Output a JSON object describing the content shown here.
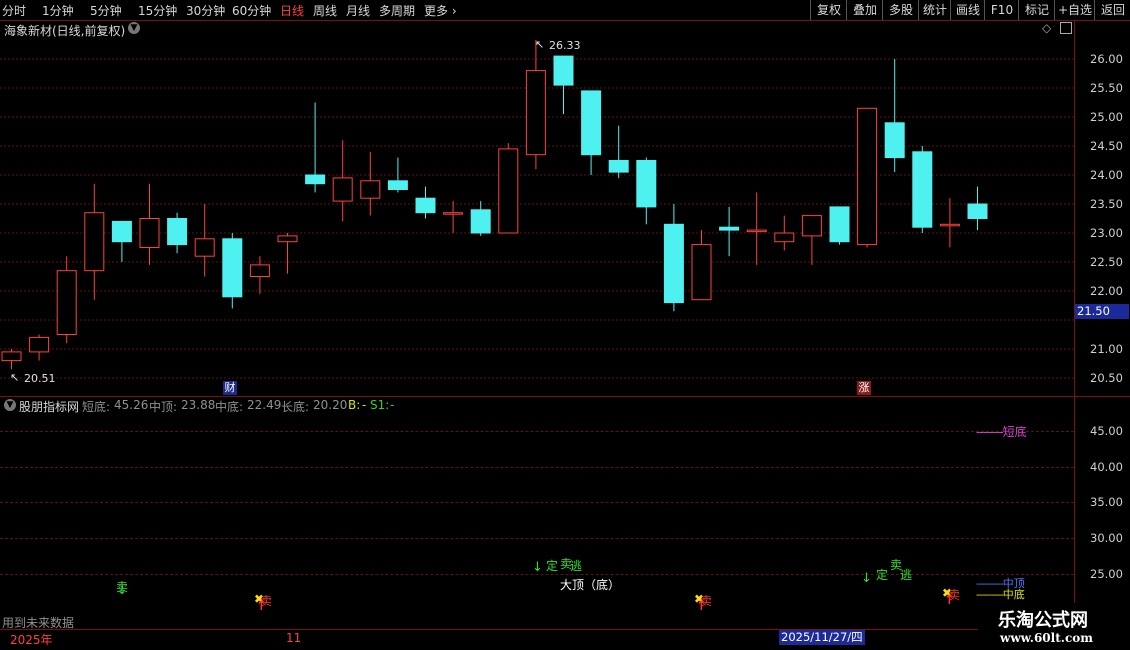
{
  "toolbar": {
    "periods": [
      "分时",
      "1分钟",
      "5分钟",
      "15分钟",
      "30分钟",
      "60分钟",
      "日线",
      "周线",
      "月线",
      "多周期",
      "更多"
    ],
    "active_period": "日线",
    "right_buttons": [
      "复权",
      "叠加",
      "多股",
      "统计",
      "画线",
      "F10",
      "标记",
      "+自选",
      "返回"
    ]
  },
  "main_title": "海象新材(日线,前复权)",
  "price_axis": {
    "labels": [
      "26.00",
      "25.50",
      "25.00",
      "24.50",
      "24.00",
      "23.50",
      "23.00",
      "22.50",
      "22.00",
      "21.50",
      "21.00",
      "20.50"
    ],
    "current_price": "21.50"
  },
  "annotations": {
    "high_label": "26.33",
    "low_label": "20.51",
    "badge_cai": "财",
    "badge_zhang": "涨"
  },
  "indicator": {
    "name": "股朋指标网",
    "params": [
      {
        "label": "短底:",
        "value": "45.26"
      },
      {
        "label": "中顶:",
        "value": "23.88"
      },
      {
        "label": "中底:",
        "value": "22.49"
      },
      {
        "label": "长底:",
        "value": "20.20"
      }
    ],
    "b_label": "B:",
    "b_value": "-",
    "s1_label": "S1:",
    "s1_value": "-",
    "axis_labels": [
      "45.00",
      "40.00",
      "35.00",
      "30.00",
      "25.00"
    ],
    "legend": [
      {
        "label": "短底",
        "color": "#d040d0"
      },
      {
        "label": "中顶",
        "color": "#4a7cff"
      },
      {
        "label": "中底",
        "color": "#e0e000"
      }
    ],
    "signal_texts": {
      "sell": "卖",
      "ding_tao": "定",
      "tao": "逃",
      "big_top": "大顶（底）"
    }
  },
  "footer": {
    "future_note": "用到未来数据",
    "year": "2025年",
    "month": "11",
    "date_cursor": "2025/11/27/四"
  },
  "watermark": {
    "name": "乐淘公式网",
    "url": "www.60lt.com"
  },
  "colors": {
    "up": "#ff4040",
    "down": "#4ff0f0",
    "grid": "#5a1212",
    "active": "#ff4040"
  },
  "chart_data": {
    "type": "candlestick",
    "ylim": [
      20.3,
      26.3
    ],
    "candles": [
      {
        "o": 20.8,
        "c": 20.95,
        "h": 21.0,
        "l": 20.65
      },
      {
        "o": 20.95,
        "c": 21.2,
        "h": 21.25,
        "l": 20.8
      },
      {
        "o": 21.25,
        "c": 22.35,
        "h": 22.6,
        "l": 21.1
      },
      {
        "o": 22.35,
        "c": 23.35,
        "h": 23.85,
        "l": 21.85
      },
      {
        "o": 23.2,
        "c": 22.85,
        "h": 23.2,
        "l": 22.5
      },
      {
        "o": 22.75,
        "c": 23.25,
        "h": 23.85,
        "l": 22.45
      },
      {
        "o": 23.25,
        "c": 22.8,
        "h": 23.35,
        "l": 22.65
      },
      {
        "o": 22.6,
        "c": 22.9,
        "h": 23.5,
        "l": 22.25
      },
      {
        "o": 22.9,
        "c": 21.9,
        "h": 23.0,
        "l": 21.7
      },
      {
        "o": 22.25,
        "c": 22.45,
        "h": 22.6,
        "l": 21.95
      },
      {
        "o": 22.85,
        "c": 22.95,
        "h": 23.0,
        "l": 22.3
      },
      {
        "o": 24.0,
        "c": 23.85,
        "h": 25.25,
        "l": 23.7
      },
      {
        "o": 23.55,
        "c": 23.95,
        "h": 24.6,
        "l": 23.2
      },
      {
        "o": 23.6,
        "c": 23.9,
        "h": 24.4,
        "l": 23.3
      },
      {
        "o": 23.9,
        "c": 23.75,
        "h": 24.3,
        "l": 23.7
      },
      {
        "o": 23.6,
        "c": 23.35,
        "h": 23.8,
        "l": 23.25
      },
      {
        "o": 23.35,
        "c": 23.35,
        "h": 23.55,
        "l": 23.0
      },
      {
        "o": 23.4,
        "c": 23.0,
        "h": 23.55,
        "l": 22.95
      },
      {
        "o": 23.0,
        "c": 24.45,
        "h": 24.55,
        "l": 23.0
      },
      {
        "o": 24.35,
        "c": 25.8,
        "h": 26.33,
        "l": 24.1
      },
      {
        "o": 26.05,
        "c": 25.55,
        "h": 26.05,
        "l": 25.05
      },
      {
        "o": 25.45,
        "c": 24.35,
        "h": 25.45,
        "l": 24.0
      },
      {
        "o": 24.25,
        "c": 24.05,
        "h": 24.85,
        "l": 23.95
      },
      {
        "o": 24.25,
        "c": 23.45,
        "h": 24.3,
        "l": 23.15
      },
      {
        "o": 23.15,
        "c": 21.8,
        "h": 23.5,
        "l": 21.65
      },
      {
        "o": 21.85,
        "c": 22.8,
        "h": 23.05,
        "l": 21.85
      },
      {
        "o": 23.1,
        "c": 23.05,
        "h": 23.45,
        "l": 22.6
      },
      {
        "o": 23.05,
        "c": 23.05,
        "h": 23.7,
        "l": 22.45
      },
      {
        "o": 22.85,
        "c": 23.0,
        "h": 23.3,
        "l": 22.7
      },
      {
        "o": 22.95,
        "c": 23.3,
        "h": 23.3,
        "l": 22.45
      },
      {
        "o": 23.45,
        "c": 22.85,
        "h": 23.45,
        "l": 22.8
      },
      {
        "o": 22.8,
        "c": 25.15,
        "h": 25.15,
        "l": 22.75
      },
      {
        "o": 24.9,
        "c": 24.3,
        "h": 26.0,
        "l": 24.05
      },
      {
        "o": 24.4,
        "c": 23.1,
        "h": 24.5,
        "l": 23.0
      },
      {
        "o": 23.15,
        "c": 23.15,
        "h": 23.6,
        "l": 22.75
      },
      {
        "o": 23.5,
        "c": 23.25,
        "h": 23.8,
        "l": 23.05
      }
    ]
  }
}
